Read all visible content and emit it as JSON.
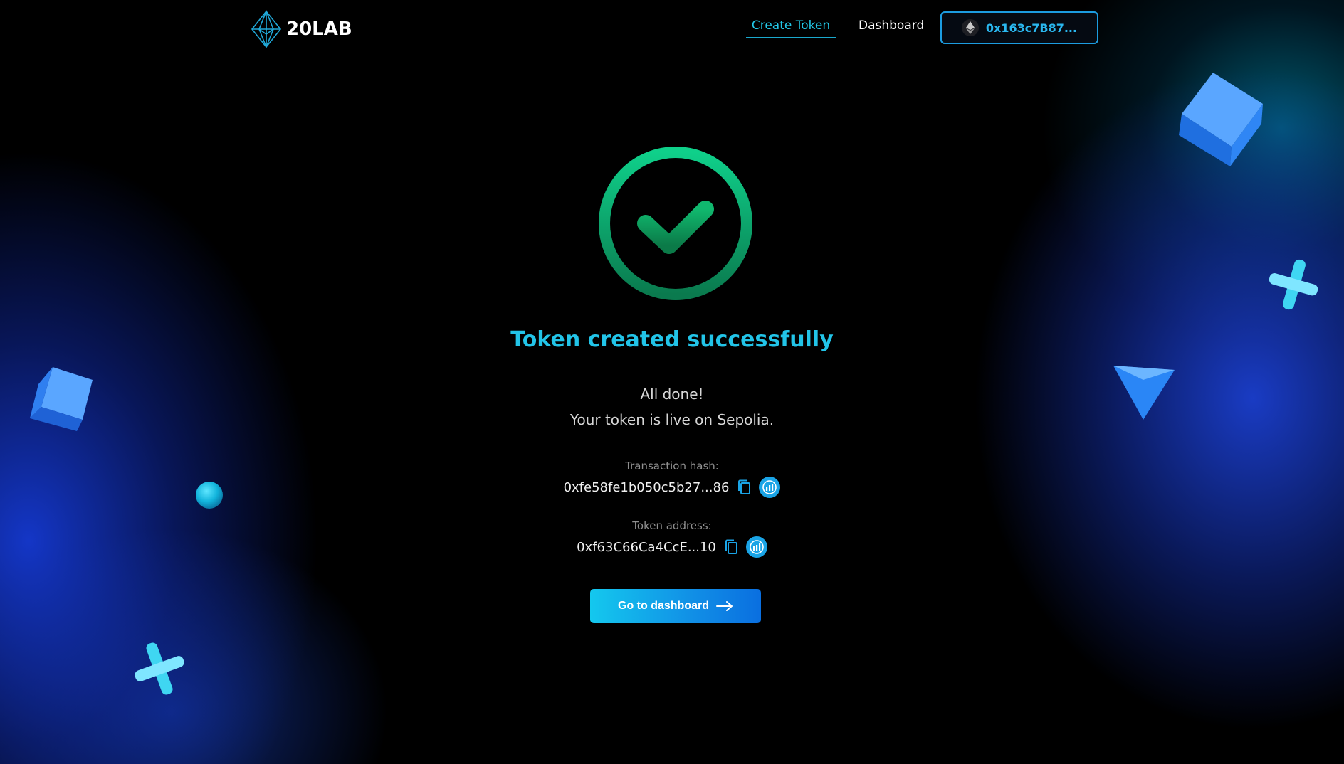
{
  "header": {
    "logo_text": "20LAB",
    "nav": {
      "create_token": "Create Token",
      "dashboard": "Dashboard"
    },
    "wallet": {
      "address": "0x163c7B87...",
      "network_icon": "ethereum-icon"
    }
  },
  "main": {
    "status_icon": "check-circle-icon",
    "title": "Token created successfully",
    "message_line1": "All done!",
    "message_line2": "Your token is live on Sepolia.",
    "transaction": {
      "label": "Transaction hash:",
      "value": "0xfe58fe1b050c5b27...86",
      "copy_icon": "copy-icon",
      "explorer_icon": "etherscan-icon"
    },
    "token": {
      "label": "Token address:",
      "value": "0xf63C66Ca4CcE...10",
      "copy_icon": "copy-icon",
      "explorer_icon": "etherscan-icon"
    },
    "dashboard_button": {
      "label": "Go to dashboard",
      "icon": "arrow-right-icon"
    }
  },
  "colors": {
    "accent": "#22c4e8",
    "success": "#0fbf78",
    "button_start": "#14c8ee",
    "button_end": "#0a6fe0",
    "background": "#000000"
  }
}
